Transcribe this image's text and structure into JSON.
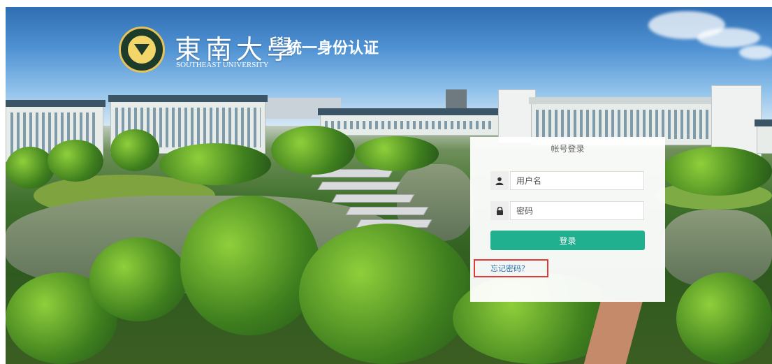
{
  "header": {
    "university_cn": "東南大學",
    "university_en": "SOUTHEAST UNIVERSITY",
    "system_title": "统一身份认证"
  },
  "login": {
    "title": "帐号登录",
    "username_placeholder": "用户名",
    "password_placeholder": "密码",
    "submit_label": "登录",
    "forgot_label": "忘记密码？"
  },
  "colors": {
    "primary_button": "#20b08f",
    "highlight_border": "#e23a3a"
  },
  "icons": {
    "user": "user-icon",
    "lock": "lock-icon",
    "seal": "university-seal"
  }
}
